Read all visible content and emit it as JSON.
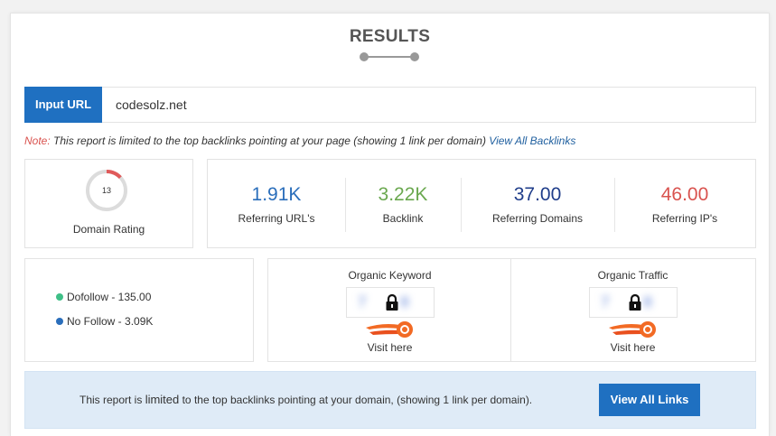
{
  "title": "RESULTS",
  "url_bar": {
    "label": "Input URL",
    "value": "codesolz.net"
  },
  "note": {
    "label": "Note:",
    "text": "This report is limited to the top backlinks pointing at your page (showing 1 link per domain)",
    "link": "View All Backlinks"
  },
  "domain_rating": {
    "value": "13",
    "label": "Domain Rating",
    "fraction": 0.13,
    "ring_color": "#e05a5a"
  },
  "stats": [
    {
      "value": "1.91K",
      "label": "Referring URL's",
      "color": "#2a6ebb"
    },
    {
      "value": "3.22K",
      "label": "Backlink",
      "color": "#6aa84f"
    },
    {
      "value": "37.00",
      "label": "Referring Domains",
      "color": "#1f3d8a"
    },
    {
      "value": "46.00",
      "label": "Referring IP's",
      "color": "#d9534f"
    }
  ],
  "follow": {
    "dofollow": {
      "label": "Dofollow - 135.00",
      "color": "#3fbf87"
    },
    "nofollow": {
      "label": "No Follow - 3.09K",
      "color": "#2a6ebb"
    }
  },
  "organic": [
    {
      "title": "Organic Keyword",
      "link": "Visit here"
    },
    {
      "title": "Organic Traffic",
      "link": "Visit here"
    }
  ],
  "banner": {
    "text_before": "This report is ",
    "text_strong": "limited",
    "text_after": " to the top backlinks pointing at your domain, (showing 1 link per domain).",
    "button": "View All Links"
  },
  "colors": {
    "primary": "#1f70c1",
    "banner_bg": "#dfebf7"
  },
  "icons": [
    "lock-icon",
    "semrush-fireball-icon",
    "dot-icon"
  ]
}
